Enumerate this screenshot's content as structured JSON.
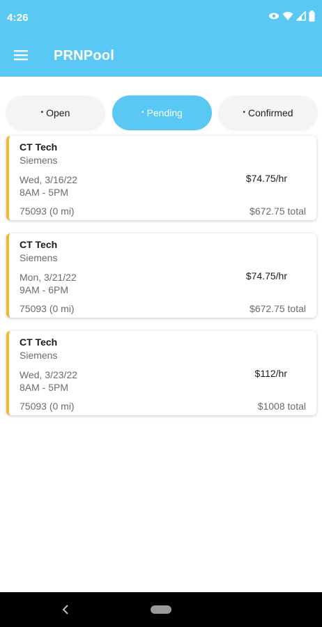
{
  "status_bar": {
    "time": "4:26",
    "icons": [
      "eye-icon",
      "wifi-icon",
      "signal-icon",
      "battery-icon"
    ]
  },
  "app_bar": {
    "title": "PRNPool",
    "menu_icon": "hamburger-menu-icon"
  },
  "tabs": [
    {
      "label": "Open",
      "active": false
    },
    {
      "label": "Pending",
      "active": true
    },
    {
      "label": "Confirmed",
      "active": false
    }
  ],
  "shifts": [
    {
      "title": "CT Tech",
      "company": "Siemens",
      "date": "Wed, 3/16/22",
      "hours": "8AM - 5PM",
      "rate": "$74.75/hr",
      "location": "75093 (0 mi)",
      "total": "$672.75 total"
    },
    {
      "title": "CT Tech",
      "company": "Siemens",
      "date": "Mon, 3/21/22",
      "hours": "9AM - 6PM",
      "rate": "$74.75/hr",
      "location": "75093 (0 mi)",
      "total": "$672.75 total"
    },
    {
      "title": "CT Tech",
      "company": "Siemens",
      "date": "Wed, 3/23/22",
      "hours": "8AM - 5PM",
      "rate": "$112/hr",
      "location": "75093 (0 mi)",
      "total": "$1008 total"
    }
  ],
  "colors": {
    "accent": "#5ac8f5",
    "pending_stripe": "#f5b731",
    "tab_inactive_bg": "#f3f4f6"
  },
  "nav_bar": {
    "icons": [
      "back-icon",
      "home-pill-icon"
    ]
  }
}
